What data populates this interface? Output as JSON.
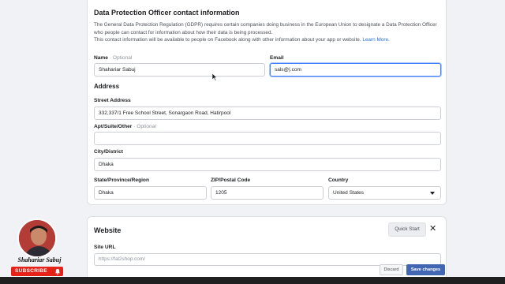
{
  "dpo": {
    "title": "Data Protection Officer contact information",
    "description": "The General Data Protection Regulation (GDPR) requires certain companies doing business in the European Union to designate a Data Protection Officer who people can contact for information about how their data is being processed.",
    "description2": "This contact information will be available to people on Facebook along with other information about your app or website.",
    "learn_more": "Learn More.",
    "name_label": "Name",
    "optional": "· Optional",
    "name_value": "Shahariar Sabuj",
    "email_label": "Email",
    "email_value": "sals@|.com",
    "address_title": "Address",
    "street_label": "Street Address",
    "street_value": "332,337/1 Free School Street, Sonargaon Road, Hatirpool",
    "apt_label": "Apt/Suite/Other",
    "apt_value": "",
    "city_label": "City/District",
    "city_value": "Dhaka",
    "state_label": "State/Province/Region",
    "state_value": "Dhaka",
    "zip_label": "ZIP/Postal Code",
    "zip_value": "1205",
    "country_label": "Country",
    "country_value": "United States"
  },
  "website": {
    "title": "Website",
    "quick_start": "Quick Start",
    "close": "✕",
    "site_url_label": "Site URL",
    "site_url_value": "https://fal2shop.com/"
  },
  "footer": {
    "discard": "Discard",
    "save": "Save changes"
  },
  "overlay": {
    "channel_name": "Shahariar Sabuj",
    "subscribe": "SUBSCRIBE"
  },
  "colors": {
    "accent": "#4267b2",
    "link": "#216fdb",
    "subscribe_red": "#e62117"
  }
}
